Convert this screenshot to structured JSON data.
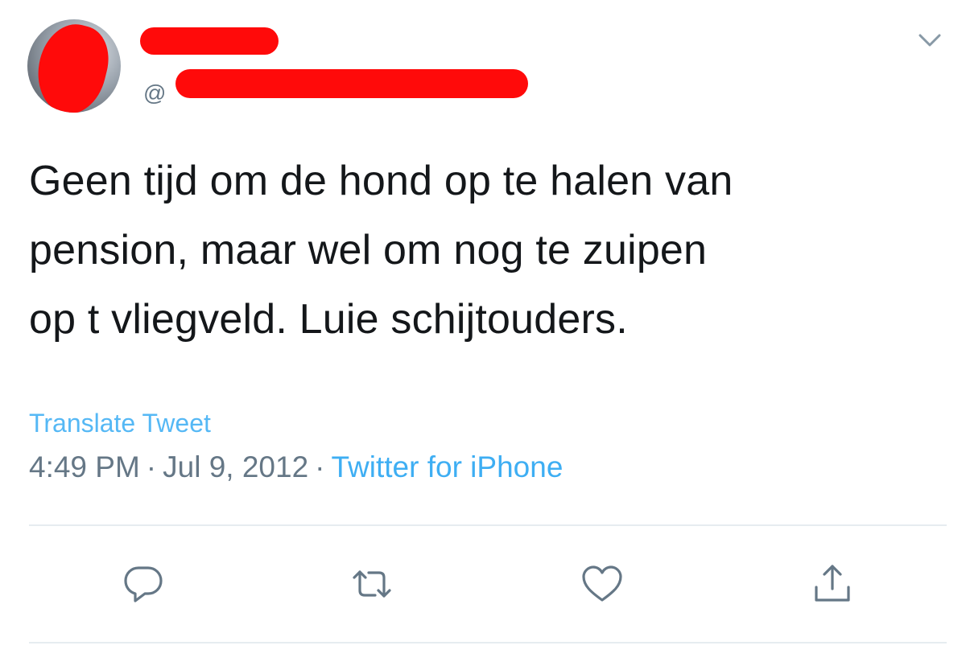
{
  "tweet": {
    "handle_prefix": "@",
    "text_lines": [
      "Geen tijd om de hond op te halen van",
      "pension, maar wel om nog te zuipen",
      "op t vliegveld. Luie schijtouders."
    ],
    "translate_label": "Translate Tweet",
    "time": "4:49 PM",
    "date": "Jul 9, 2012",
    "separator": "·",
    "source": "Twitter for iPhone"
  },
  "actions": {
    "reply_icon": "reply-icon",
    "retweet_icon": "retweet-icon",
    "like_icon": "heart-icon",
    "share_icon": "share-icon"
  },
  "colors": {
    "link": "#1da1f2",
    "muted": "#657786",
    "text": "#14171a",
    "redaction": "#ff0a0a"
  }
}
